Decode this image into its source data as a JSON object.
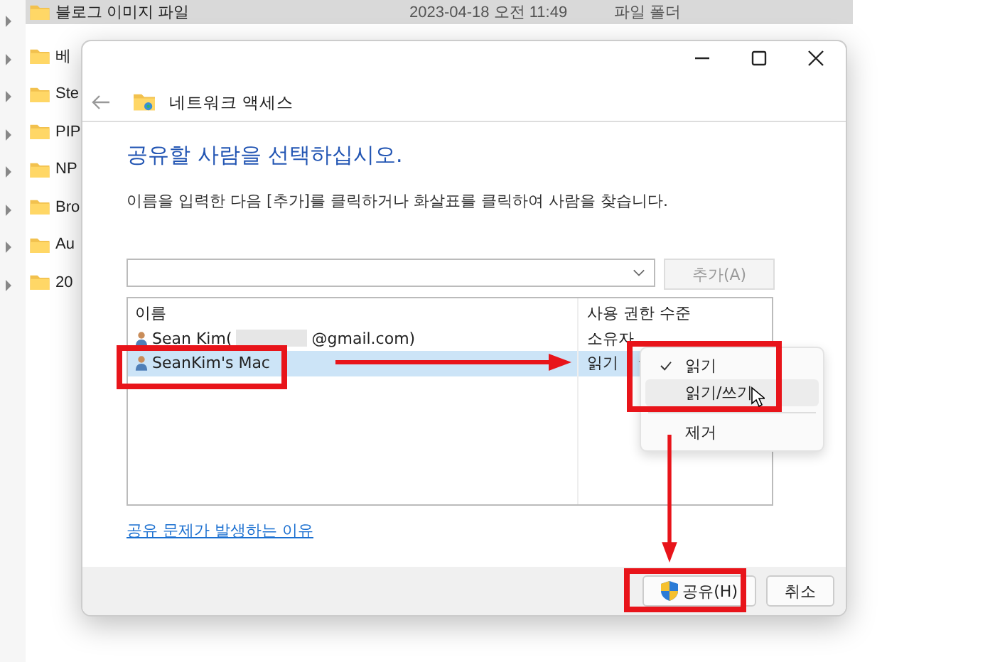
{
  "explorer": {
    "rows": [
      {
        "name": "블로그 이미지 파일",
        "date": "2023-04-18 오전 11:49",
        "type": "파일 폴더",
        "selected": true
      },
      {
        "name": "베",
        "selected": false
      },
      {
        "name": "Ste",
        "selected": false
      },
      {
        "name": "PIP",
        "selected": false
      },
      {
        "name": "NP",
        "selected": false
      },
      {
        "name": "Bro",
        "selected": false
      },
      {
        "name": "Au",
        "selected": false
      },
      {
        "name": "20",
        "selected": false
      }
    ]
  },
  "dialog": {
    "title": "네트워크 액세스",
    "heading": "공유할 사람을 선택하십시오.",
    "instruction": "이름을 입력한 다음 [추가]를 클릭하거나 화살표를 클릭하여 사람을 찾습니다.",
    "add_button": {
      "label": "추가(A)",
      "disabled": true
    },
    "table": {
      "columns": [
        "이름",
        "사용 권한 수준"
      ],
      "rows": [
        {
          "name": "Sean Kim(",
          "name_end": "@gmail.com)",
          "redacted": true,
          "permission": "소유자",
          "dropdown": false,
          "selected": false
        },
        {
          "name": "SeanKim's Mac",
          "redacted": false,
          "permission": "읽기",
          "dropdown": true,
          "selected": true
        }
      ]
    },
    "menu": [
      {
        "kind": "item",
        "label": "읽기",
        "checked": true,
        "hovered": false
      },
      {
        "kind": "item",
        "label": "읽기/쓰기",
        "checked": false,
        "hovered": true
      },
      {
        "kind": "separator"
      },
      {
        "kind": "item",
        "label": "제거",
        "checked": false,
        "hovered": false
      }
    ],
    "link": "공유 문제가 발생하는 이유",
    "buttons": [
      {
        "label": "공유(H)",
        "shield": true
      },
      {
        "label": "취소",
        "shield": false
      }
    ]
  }
}
